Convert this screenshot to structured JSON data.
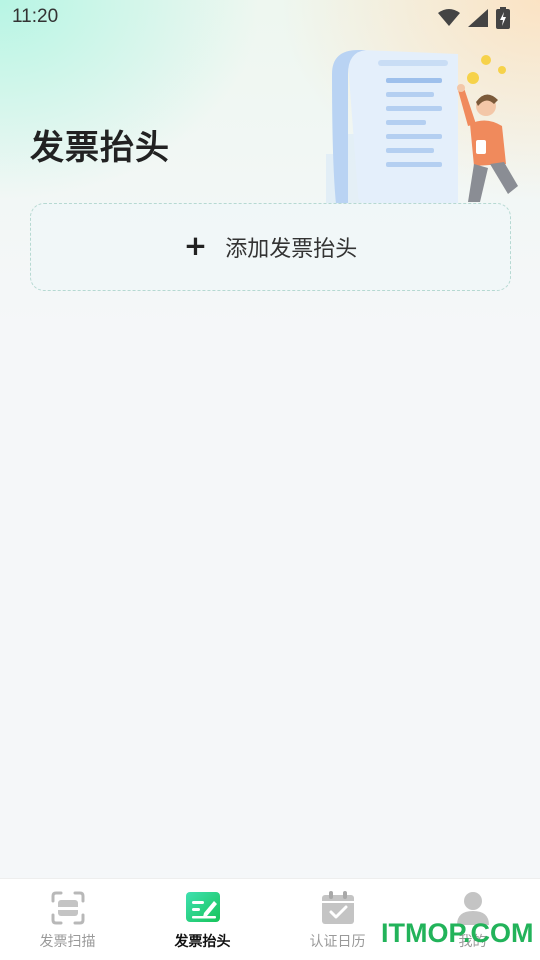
{
  "status_bar": {
    "time": "11:20",
    "icons": [
      "wifi-icon",
      "signal-icon",
      "battery-icon"
    ]
  },
  "page": {
    "title": "发票抬头"
  },
  "add_card": {
    "icon": "plus",
    "plus_glyph": "+",
    "label": "添加发票抬头"
  },
  "nav": {
    "items": [
      {
        "label": "发票扫描",
        "icon": "scan-icon",
        "active": false
      },
      {
        "label": "发票抬头",
        "icon": "invoice-edit-icon",
        "active": true
      },
      {
        "label": "认证日历",
        "icon": "calendar-check-icon",
        "active": false
      },
      {
        "label": "我的",
        "icon": "user-icon",
        "active": false
      }
    ]
  },
  "watermark": "ITMOP.COM",
  "colors": {
    "accent_green": "#22b35a",
    "title": "#222222",
    "nav_inactive": "#9a9a9a"
  }
}
